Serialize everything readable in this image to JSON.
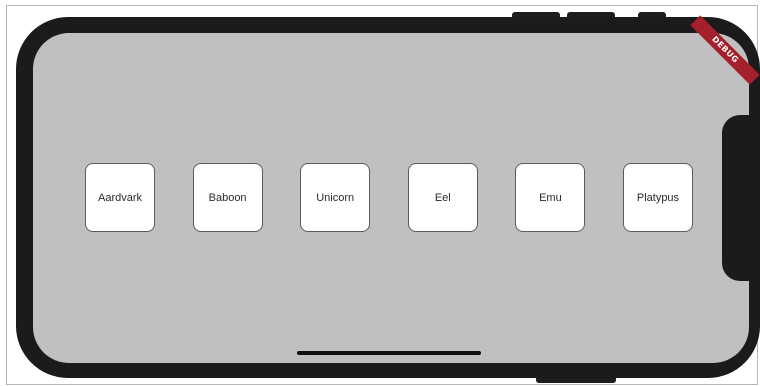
{
  "debug_banner": {
    "label": "DEBUG"
  },
  "items": [
    {
      "label": "Aardvark"
    },
    {
      "label": "Baboon"
    },
    {
      "label": "Unicorn"
    },
    {
      "label": "Eel"
    },
    {
      "label": "Emu"
    },
    {
      "label": "Platypus"
    }
  ],
  "colors": {
    "screen_background": "#c0c0c0",
    "device_frame": "#1b1b1b",
    "card_background": "#ffffff",
    "card_border": "#5c5c5c",
    "debug_banner": "#a4202a"
  }
}
